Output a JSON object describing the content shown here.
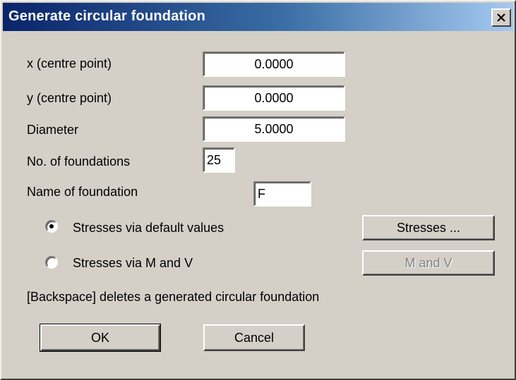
{
  "dialog": {
    "title": "Generate circular foundation",
    "close_label": "×"
  },
  "fields": {
    "x_label": "x (centre point)",
    "x_value": "0.0000",
    "y_label": "y (centre point)",
    "y_value": "0.0000",
    "diameter_label": "Diameter",
    "diameter_value": "5.0000",
    "count_label": "No. of foundations",
    "count_value": "25",
    "name_label": "Name of foundation",
    "name_value": "F"
  },
  "options": {
    "default_values_label": "Stresses via default values",
    "default_values_selected": true,
    "m_and_v_label": "Stresses via M and V",
    "m_and_v_selected": false,
    "stresses_button": "Stresses ...",
    "m_and_v_button": "M and V"
  },
  "hint": "[Backspace] deletes a generated circular foundation",
  "buttons": {
    "ok": "OK",
    "cancel": "Cancel"
  }
}
